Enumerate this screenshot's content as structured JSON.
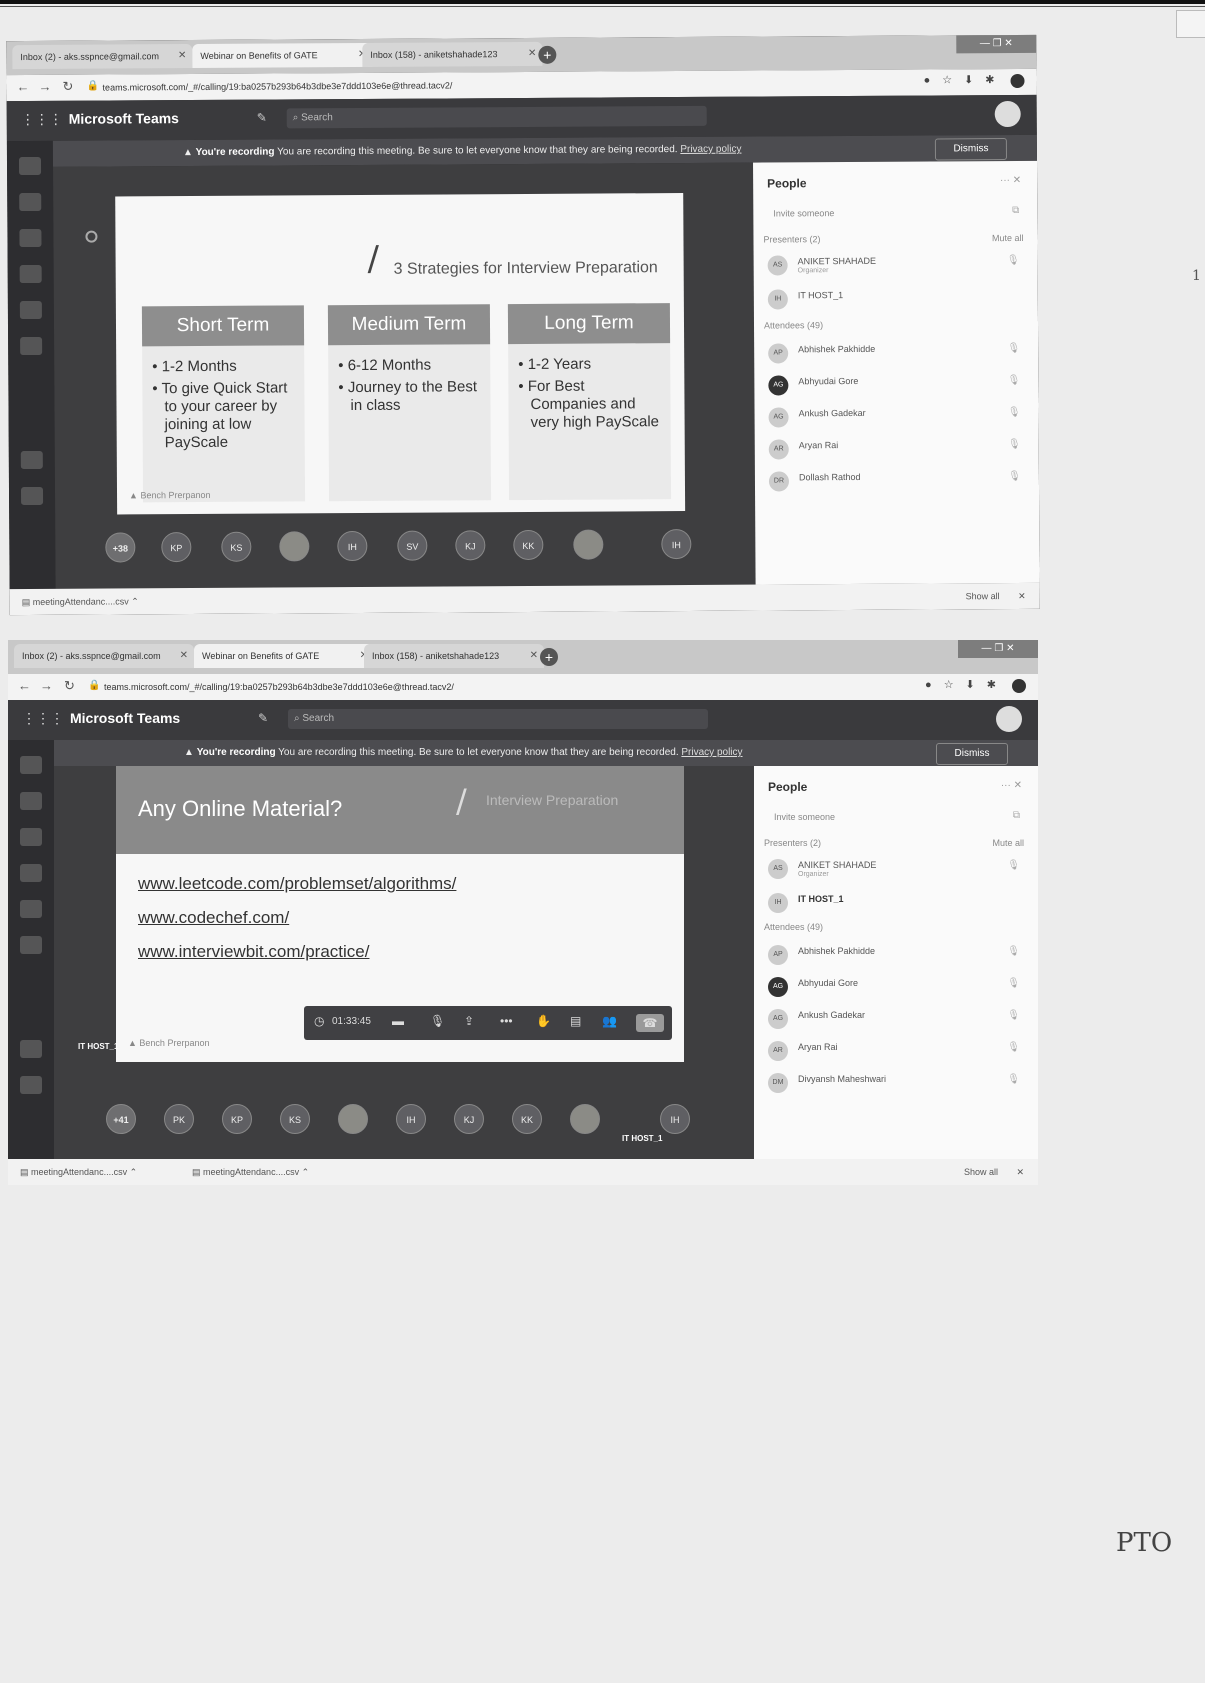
{
  "page": {
    "handwritten_note": "PTO",
    "margin_mark": "1"
  },
  "shots": [
    {
      "tabs": [
        {
          "label": "Inbox (2) - aks.sspnce@gmail.com"
        },
        {
          "label": "Webinar on Benefits of GATE"
        },
        {
          "label": "Inbox (158) - aniketshahade123"
        }
      ],
      "url": "teams.microsoft.com/_#/calling/19:ba0257b293b64b3dbe3e7ddd103e6e@thread.tacv2/",
      "app_name": "Microsoft Teams",
      "search_placeholder": "Search",
      "recording": {
        "bold": "You're recording",
        "message": "You are recording this meeting. Be sure to let everyone know that they are being recorded.",
        "link": "Privacy policy",
        "dismiss": "Dismiss"
      },
      "slide": {
        "title": "3 Strategies for Interview Preparation",
        "columns": [
          {
            "heading": "Short Term",
            "bullets": [
              "1-2 Months",
              "To give Quick Start to your career by joining at low PayScale"
            ]
          },
          {
            "heading": "Medium Term",
            "bullets": [
              "6-12 Months",
              "Journey to the Best in class"
            ]
          },
          {
            "heading": "Long Term",
            "bullets": [
              "1-2 Years",
              "For Best Companies and very high PayScale"
            ]
          }
        ],
        "logo_text": "Bench Prerpanon"
      },
      "people": {
        "title": "People",
        "invite": "Invite someone",
        "presenters_label": "Presenters (2)",
        "mute_all": "Mute all",
        "presenters": [
          {
            "initials": "AS",
            "name": "ANIKET SHAHADE",
            "role": "Organizer"
          },
          {
            "initials": "IH",
            "name": "IT HOST_1",
            "role": ""
          }
        ],
        "attendees_label": "Attendees (49)",
        "attendees": [
          {
            "initials": "AP",
            "name": "Abhishek Pakhidde"
          },
          {
            "initials": "AG",
            "name": "Abhyudai Gore"
          },
          {
            "initials": "AG",
            "name": "Ankush Gadekar"
          },
          {
            "initials": "AR",
            "name": "Aryan Rai"
          },
          {
            "initials": "DR",
            "name": "Dollash Rathod"
          }
        ]
      },
      "avatar_strip": [
        "+38",
        "KP",
        "KS",
        "",
        "IH",
        "SV",
        "KJ",
        "KK",
        "",
        "IH"
      ],
      "downloads": [
        "meetingAttendanc....csv"
      ],
      "show_all": "Show all"
    },
    {
      "tabs": [
        {
          "label": "Inbox (2) - aks.sspnce@gmail.com"
        },
        {
          "label": "Webinar on Benefits of GATE"
        },
        {
          "label": "Inbox (158) - aniketshahade123"
        }
      ],
      "url": "teams.microsoft.com/_#/calling/19:ba0257b293b64b3dbe3e7ddd103e6e@thread.tacv2/",
      "app_name": "Microsoft Teams",
      "search_placeholder": "Search",
      "recording": {
        "bold": "You're recording",
        "message": "You are recording this meeting. Be sure to let everyone know that they are being recorded.",
        "link": "Privacy policy",
        "dismiss": "Dismiss"
      },
      "slide": {
        "title": "Any Online Material?",
        "subtitle": "Interview Preparation",
        "links": [
          "www.leetcode.com/problemset/algorithms/",
          "www.codechef.com/",
          "www.interviewbit.com/practice/"
        ],
        "logo_text": "Bench Prerpanon",
        "host_label": "IT HOST_1"
      },
      "call_time": "01:33:45",
      "people": {
        "title": "People",
        "invite": "Invite someone",
        "presenters_label": "Presenters (2)",
        "mute_all": "Mute all",
        "presenters": [
          {
            "initials": "AS",
            "name": "ANIKET SHAHADE",
            "role": "Organizer"
          },
          {
            "initials": "IH",
            "name": "IT HOST_1",
            "role": ""
          }
        ],
        "attendees_label": "Attendees (49)",
        "attendees": [
          {
            "initials": "AP",
            "name": "Abhishek Pakhidde"
          },
          {
            "initials": "AG",
            "name": "Abhyudai Gore"
          },
          {
            "initials": "AG",
            "name": "Ankush Gadekar"
          },
          {
            "initials": "AR",
            "name": "Aryan Rai"
          },
          {
            "initials": "DM",
            "name": "Divyansh Maheshwari"
          }
        ]
      },
      "avatar_strip": [
        "+41",
        "PK",
        "KP",
        "KS",
        "",
        "IH",
        "KJ",
        "KK",
        "",
        "IH"
      ],
      "avatar_strip_label": "IT HOST_1",
      "downloads": [
        "meetingAttendanc....csv",
        "meetingAttendanc....csv"
      ],
      "show_all": "Show all"
    }
  ]
}
